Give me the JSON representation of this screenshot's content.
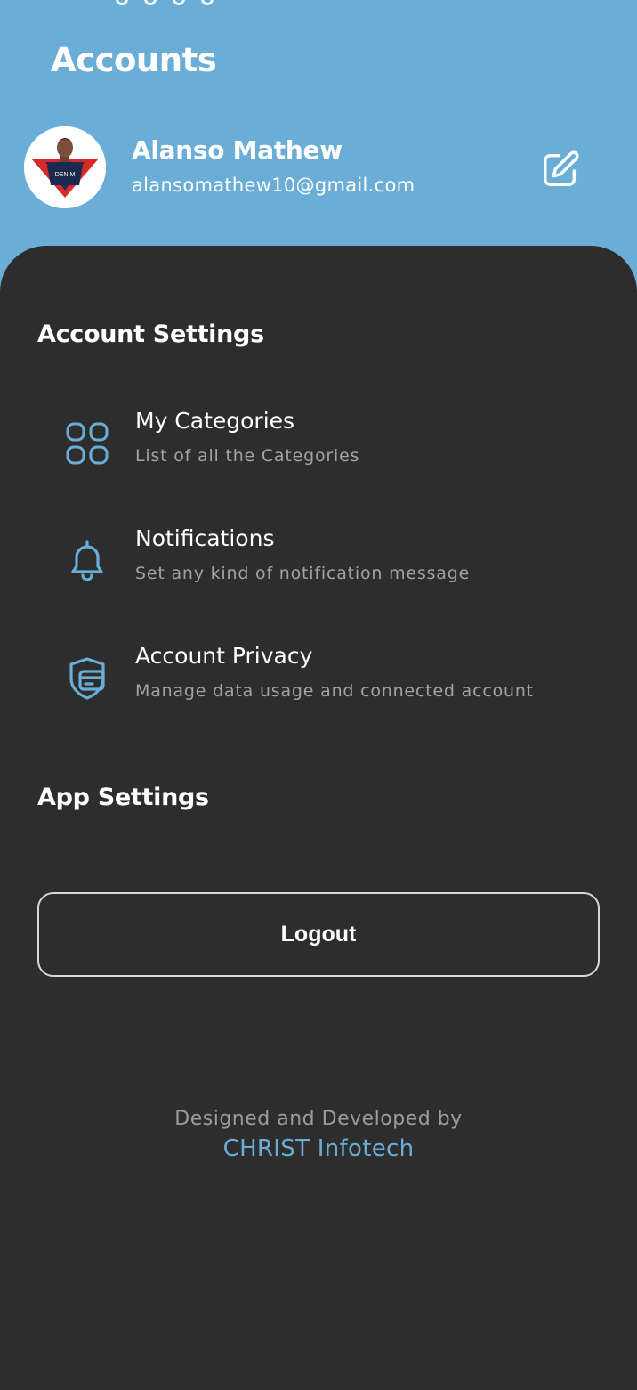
{
  "header": {
    "title": "Accounts",
    "background_color": "#6aaed8"
  },
  "profile": {
    "name": "Alanso Mathew",
    "email": "alansomathew10@gmail.com",
    "avatar_icon": "user-photo",
    "avatar_shirt_text": "DENIM",
    "edit_icon": "edit-icon"
  },
  "account_settings": {
    "title": "Account Settings",
    "items": [
      {
        "icon": "grid-icon",
        "title": "My Categories",
        "subtitle": "List of all the Categories"
      },
      {
        "icon": "bell-icon",
        "title": "Notifications",
        "subtitle": "Set any kind of notification message"
      },
      {
        "icon": "privacy-card-icon",
        "title": "Account Privacy",
        "subtitle": "Manage data usage and connected account"
      }
    ]
  },
  "app_settings": {
    "title": "App Settings"
  },
  "logout": {
    "label": "Logout"
  },
  "footer": {
    "credit": "Designed and Developed by",
    "company": "CHRIST Infotech",
    "company_color": "#6aaed8"
  },
  "colors": {
    "panel": "#2d2d2d",
    "accent": "#6aaed8",
    "subtitle": "#a3a3a3"
  }
}
